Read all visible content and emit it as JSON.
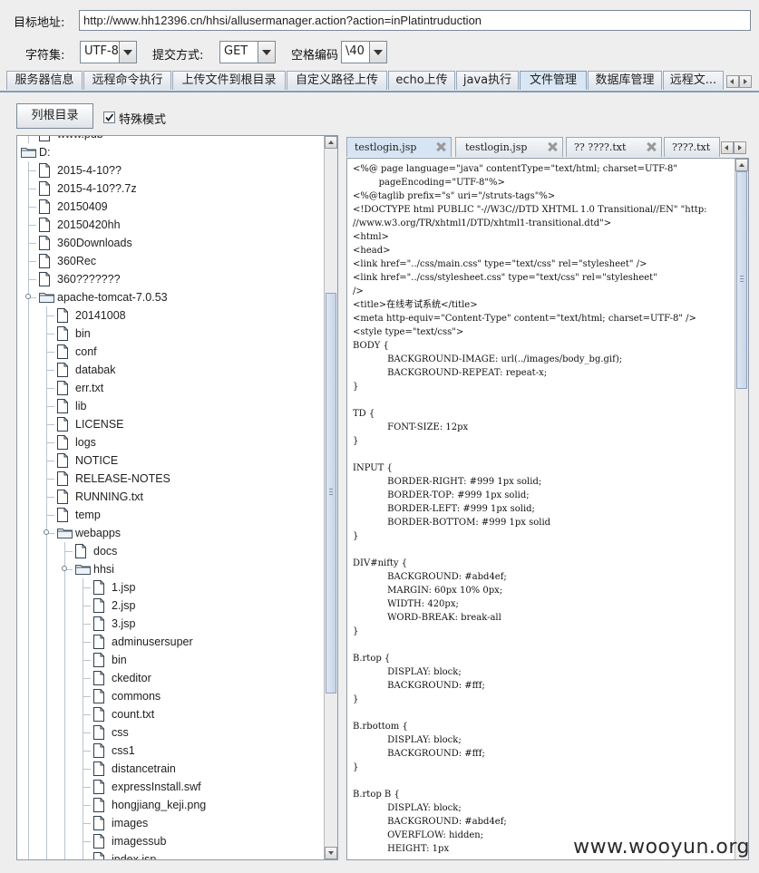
{
  "toolbar": {
    "url_label": "目标地址:",
    "url_value": "http://www.hh12396.cn/hhsi/allusermanager.action?action=inPlatintruduction",
    "charset_label": "字符集:",
    "charset_value": "UTF-8",
    "method_label": "提交方式:",
    "method_value": "GET",
    "space_label": "空格编码",
    "space_value": "\\40"
  },
  "main_tabs": [
    {
      "label": "服务器信息"
    },
    {
      "label": "远程命令执行"
    },
    {
      "label": "上传文件到根目录"
    },
    {
      "label": "自定义路径上传"
    },
    {
      "label": "echo上传"
    },
    {
      "label": "java执行"
    },
    {
      "label": "文件管理",
      "active": true
    },
    {
      "label": "数据库管理"
    },
    {
      "label": "远程文..."
    }
  ],
  "file_manager": {
    "list_root_button": "列根目录",
    "special_mode_label": "特殊模式",
    "special_mode_checked": true
  },
  "tree": [
    {
      "label": "www.pdb",
      "type": "file",
      "depth": 1
    },
    {
      "label": "D:",
      "type": "folder",
      "depth": 0
    },
    {
      "label": "2015-4-10??",
      "type": "file",
      "depth": 1
    },
    {
      "label": "2015-4-10??.7z",
      "type": "file",
      "depth": 1
    },
    {
      "label": "20150409",
      "type": "file",
      "depth": 1
    },
    {
      "label": "20150420hh",
      "type": "file",
      "depth": 1
    },
    {
      "label": "360Downloads",
      "type": "file",
      "depth": 1
    },
    {
      "label": "360Rec",
      "type": "file",
      "depth": 1
    },
    {
      "label": "360???????",
      "type": "file",
      "depth": 1
    },
    {
      "label": "apache-tomcat-7.0.53",
      "type": "folder",
      "depth": 1,
      "expanded": true
    },
    {
      "label": "20141008",
      "type": "file",
      "depth": 2
    },
    {
      "label": "bin",
      "type": "file",
      "depth": 2
    },
    {
      "label": "conf",
      "type": "file",
      "depth": 2
    },
    {
      "label": "databak",
      "type": "file",
      "depth": 2
    },
    {
      "label": "err.txt",
      "type": "file",
      "depth": 2
    },
    {
      "label": "lib",
      "type": "file",
      "depth": 2
    },
    {
      "label": "LICENSE",
      "type": "file",
      "depth": 2
    },
    {
      "label": "logs",
      "type": "file",
      "depth": 2
    },
    {
      "label": "NOTICE",
      "type": "file",
      "depth": 2
    },
    {
      "label": "RELEASE-NOTES",
      "type": "file",
      "depth": 2
    },
    {
      "label": "RUNNING.txt",
      "type": "file",
      "depth": 2
    },
    {
      "label": "temp",
      "type": "file",
      "depth": 2
    },
    {
      "label": "webapps",
      "type": "folder",
      "depth": 2,
      "expanded": true
    },
    {
      "label": "docs",
      "type": "file",
      "depth": 3
    },
    {
      "label": "hhsi",
      "type": "folder",
      "depth": 3,
      "expanded": true
    },
    {
      "label": "1.jsp",
      "type": "file",
      "depth": 4
    },
    {
      "label": "2.jsp",
      "type": "file",
      "depth": 4
    },
    {
      "label": "3.jsp",
      "type": "file",
      "depth": 4
    },
    {
      "label": "adminusersuper",
      "type": "file",
      "depth": 4
    },
    {
      "label": "bin",
      "type": "file",
      "depth": 4
    },
    {
      "label": "ckeditor",
      "type": "file",
      "depth": 4
    },
    {
      "label": "commons",
      "type": "file",
      "depth": 4
    },
    {
      "label": "count.txt",
      "type": "file",
      "depth": 4
    },
    {
      "label": "css",
      "type": "file",
      "depth": 4
    },
    {
      "label": "css1",
      "type": "file",
      "depth": 4
    },
    {
      "label": "distancetrain",
      "type": "file",
      "depth": 4
    },
    {
      "label": "expressInstall.swf",
      "type": "file",
      "depth": 4
    },
    {
      "label": "hongjiang_keji.png",
      "type": "file",
      "depth": 4
    },
    {
      "label": "images",
      "type": "file",
      "depth": 4
    },
    {
      "label": "imagessub",
      "type": "file",
      "depth": 4
    },
    {
      "label": "index.jsp",
      "type": "file",
      "depth": 4
    }
  ],
  "file_tabs": [
    {
      "label": "testlogin.jsp",
      "active": true
    },
    {
      "label": "testlogin.jsp"
    },
    {
      "label": "?? ????.txt"
    },
    {
      "label": "????.txt"
    }
  ],
  "code_lines": [
    "<%@ page language=\"java\" contentType=\"text/html; charset=UTF-8\"",
    "         pageEncoding=\"UTF-8\"%>",
    "<%@taglib prefix=\"s\" uri=\"/struts-tags\"%>",
    "<!DOCTYPE html PUBLIC \"-//W3C//DTD XHTML 1.0 Transitional//EN\" \"http:",
    "//www.w3.org/TR/xhtml1/DTD/xhtml1-transitional.dtd\">",
    "<html>",
    "<head>",
    "<link href=\"../css/main.css\" type=\"text/css\" rel=\"stylesheet\" />",
    "<link href=\"../css/stylesheet.css\" type=\"text/css\" rel=\"stylesheet\"",
    "/>",
    "<title>在线考试系统</title>",
    "<meta http-equiv=\"Content-Type\" content=\"text/html; charset=UTF-8\" />",
    "<style type=\"text/css\">",
    "BODY {",
    "            BACKGROUND-IMAGE: url(../images/body_bg.gif);",
    "            BACKGROUND-REPEAT: repeat-x;",
    "}",
    "",
    "TD {",
    "            FONT-SIZE: 12px",
    "}",
    "",
    "INPUT {",
    "            BORDER-RIGHT: #999 1px solid;",
    "            BORDER-TOP: #999 1px solid;",
    "            BORDER-LEFT: #999 1px solid;",
    "            BORDER-BOTTOM: #999 1px solid",
    "}",
    "",
    "DIV#nifty {",
    "            BACKGROUND: #abd4ef;",
    "            MARGIN: 60px 10% 0px;",
    "            WIDTH: 420px;",
    "            WORD-BREAK: break-all",
    "}",
    "",
    "B.rtop {",
    "            DISPLAY: block;",
    "            BACKGROUND: #fff;",
    "}",
    "",
    "B.rbottom {",
    "            DISPLAY: block;",
    "            BACKGROUND: #fff;",
    "}",
    "",
    "B.rtop B {",
    "            DISPLAY: block;",
    "            BACKGROUND: #abd4ef;",
    "            OVERFLOW: hidden;",
    "            HEIGHT: 1px"
  ],
  "watermark": "www.wooyun.org"
}
